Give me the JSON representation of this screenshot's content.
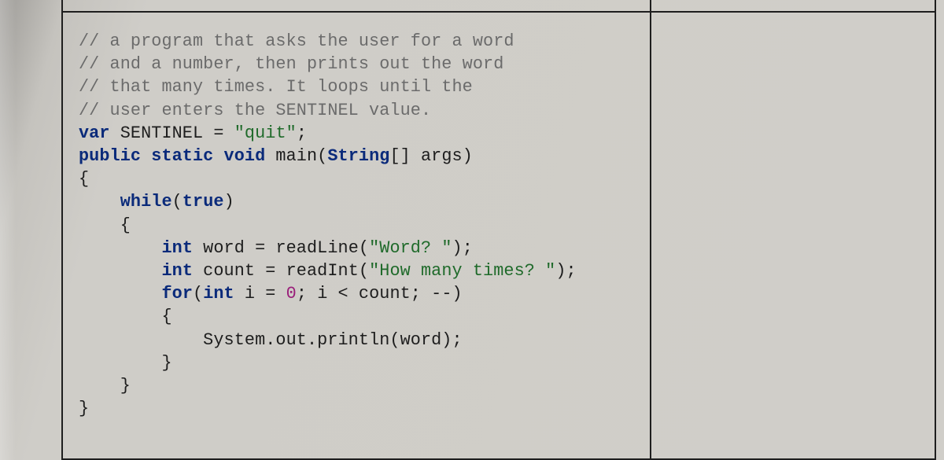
{
  "code": {
    "c1": "// a program that asks the user for a word",
    "c2": "// and a number, then prints out the word",
    "c3": "// that many times. It loops until the",
    "c4": "// user enters the SENTINEL value.",
    "l5_a": "var",
    "l5_b": " SENTINEL = ",
    "l5_c": "\"quit\"",
    "l5_d": ";",
    "l6_a": "public static void",
    "l6_b": " main(",
    "l6_c": "String",
    "l6_d": "[] args)",
    "l7": "{",
    "l8_a": "    ",
    "l8_b": "while",
    "l8_c": "(",
    "l8_d": "true",
    "l8_e": ")",
    "l9": "    {",
    "l10_a": "        ",
    "l10_b": "int",
    "l10_c": " word = readLine(",
    "l10_d": "\"Word? \"",
    "l10_e": ");",
    "l11_a": "        ",
    "l11_b": "int",
    "l11_c": " count = readInt(",
    "l11_d": "\"How many times? \"",
    "l11_e": ");",
    "l12_a": "        ",
    "l12_b": "for",
    "l12_c": "(",
    "l12_d": "int",
    "l12_e": " i = ",
    "l12_f": "0",
    "l12_g": "; i < count; --)",
    "l13": "        {",
    "l14": "            System.out.println(word);",
    "l15": "        }",
    "l16": "    }",
    "l17": "}"
  }
}
